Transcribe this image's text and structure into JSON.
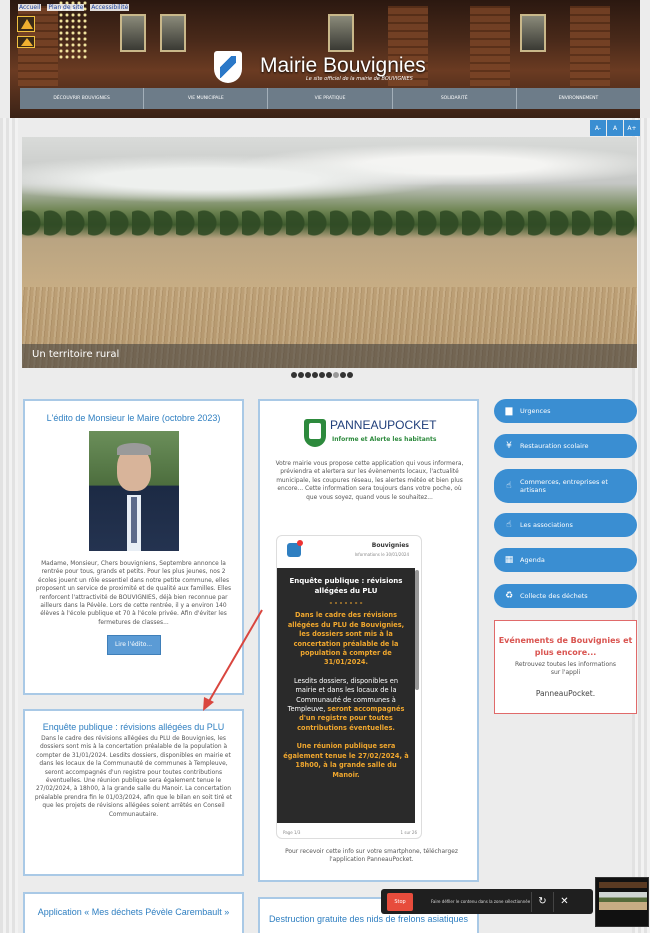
{
  "top_links": [
    "Accueil",
    "Plan de site",
    "Accessibilité"
  ],
  "site": {
    "title": "Mairie Bouvignies",
    "subtitle": "Le site officiel de la mairie de BOUVIGNIES"
  },
  "nav": [
    "Découvrir Bouvignies",
    "Vie municipale",
    "Vie pratique",
    "Solidarité",
    "Environnement"
  ],
  "font_size_controls": [
    "A-",
    "A",
    "A+"
  ],
  "slideshow": {
    "caption": "Un territoire rural",
    "dots_total": 9,
    "dots_active": [
      0,
      1,
      2,
      3,
      4,
      5,
      7,
      8
    ]
  },
  "edito": {
    "title": "L'édito de Monsieur le Maire (octobre 2023)",
    "text": "Madame, Monsieur, Chers bouvigniens, Septembre annonce la rentrée pour tous, grands et petits. Pour les plus jeunes, nos 2 écoles jouent un rôle essentiel dans notre petite commune, elles proposent un service de proximité et de qualité aux familles. Elles renforcent l'attractivité de BOUVIGNIES, déjà bien reconnue par ailleurs dans la Pévèle. Lors de cette rentrée, il y a environ 140 élèves à l'école publique et 70 à l'école privée. Afin d'éviter les fermetures de classes...",
    "button": "Lire l'édito..."
  },
  "enquete": {
    "title": "Enquête publique : révisions allégées du PLU",
    "text": "Dans le cadre des révisions allégées du PLU de Bouvignies, les dossiers sont mis à la concertation préalable de la population à compter de 31/01/2024. Lesdits dossiers, disponibles en mairie et dans les locaux de la Communauté de communes à Templeuve, seront accompagnés d'un registre pour toutes contributions éventuelles. Une réunion publique sera également tenue le 27/02/2024, à 18h00, à la grande salle du Manoir. La concertation préalable prendra fin le 01/03/2024, afin que le bilan en soit tiré et que les projets de révisions allégées soient arrêtés en Conseil Communautaire."
  },
  "app_card": {
    "title": "Application « Mes déchets Pévèle Carembault »"
  },
  "panneaupocket": {
    "name": "PANNEAUPOCKET",
    "tagline": "Informe et Alerte les habitants",
    "intro": "Votre mairie vous propose cette application qui vous informera, préviendra et alertera sur les évènements locaux, l'actualité municipale, les coupures réseau, les alertes météo et bien plus encore... Cette information sera toujours dans votre poche, où que vous soyez, quand vous le souhaitez...",
    "phone": {
      "sender": "Bouvignies",
      "date": "Informations le 30/01/2024",
      "title": "Enquête publique : révisions allégées du PLU",
      "separator": "- - - - - - -",
      "p1": "Dans le cadre des révisions allégées du PLU de Bouvignies, les dossiers sont mis à la concertation préalable de la population à compter de 31/01/2024.",
      "p2_white": "Lesdits dossiers, disponibles en mairie et dans les locaux de la Communauté de communes à Templeuve,",
      "p2_orange": "seront accompagnés d'un registre pour toutes contributions éventuelles.",
      "p3": "Une réunion publique sera également tenue le 27/02/2024, à 18h00, à la grande salle du Manoir.",
      "foot_left": "Page 1/3",
      "foot_right": "1 sur 26"
    },
    "outro": "Pour recevoir cette info sur votre smartphone, téléchargez l'application PanneauPocket."
  },
  "frelons": {
    "title": "Destruction gratuite des nids de frelons asiatiques"
  },
  "side_menu": [
    {
      "label": "Urgences",
      "icon": "truck-icon"
    },
    {
      "label": "Restauration scolaire",
      "icon": "fork-knife-icon"
    },
    {
      "label": "Commerces, entreprises et artisans",
      "icon": "thumbs-up-icon"
    },
    {
      "label": "Les associations",
      "icon": "thumbs-up-icon"
    },
    {
      "label": "Agenda",
      "icon": "calendar-icon"
    },
    {
      "label": "Collecte des déchets",
      "icon": "recycle-icon"
    }
  ],
  "events": {
    "title": "Evénements de Bouvignies et plus encore...",
    "subtitle": "Retrouvez toutes les informations sur l'appli",
    "app": "PanneauPocket."
  },
  "recording_bar": {
    "stop": "Stop",
    "text": "Faire défiler le contenu dans la zone sélectionnée",
    "reset_icon": "↻",
    "close_icon": "✕"
  },
  "colors": {
    "accent": "#3a8ed2",
    "nav": "#6d7c89",
    "alert": "#d9534f",
    "highlight": "#f0a72e"
  }
}
